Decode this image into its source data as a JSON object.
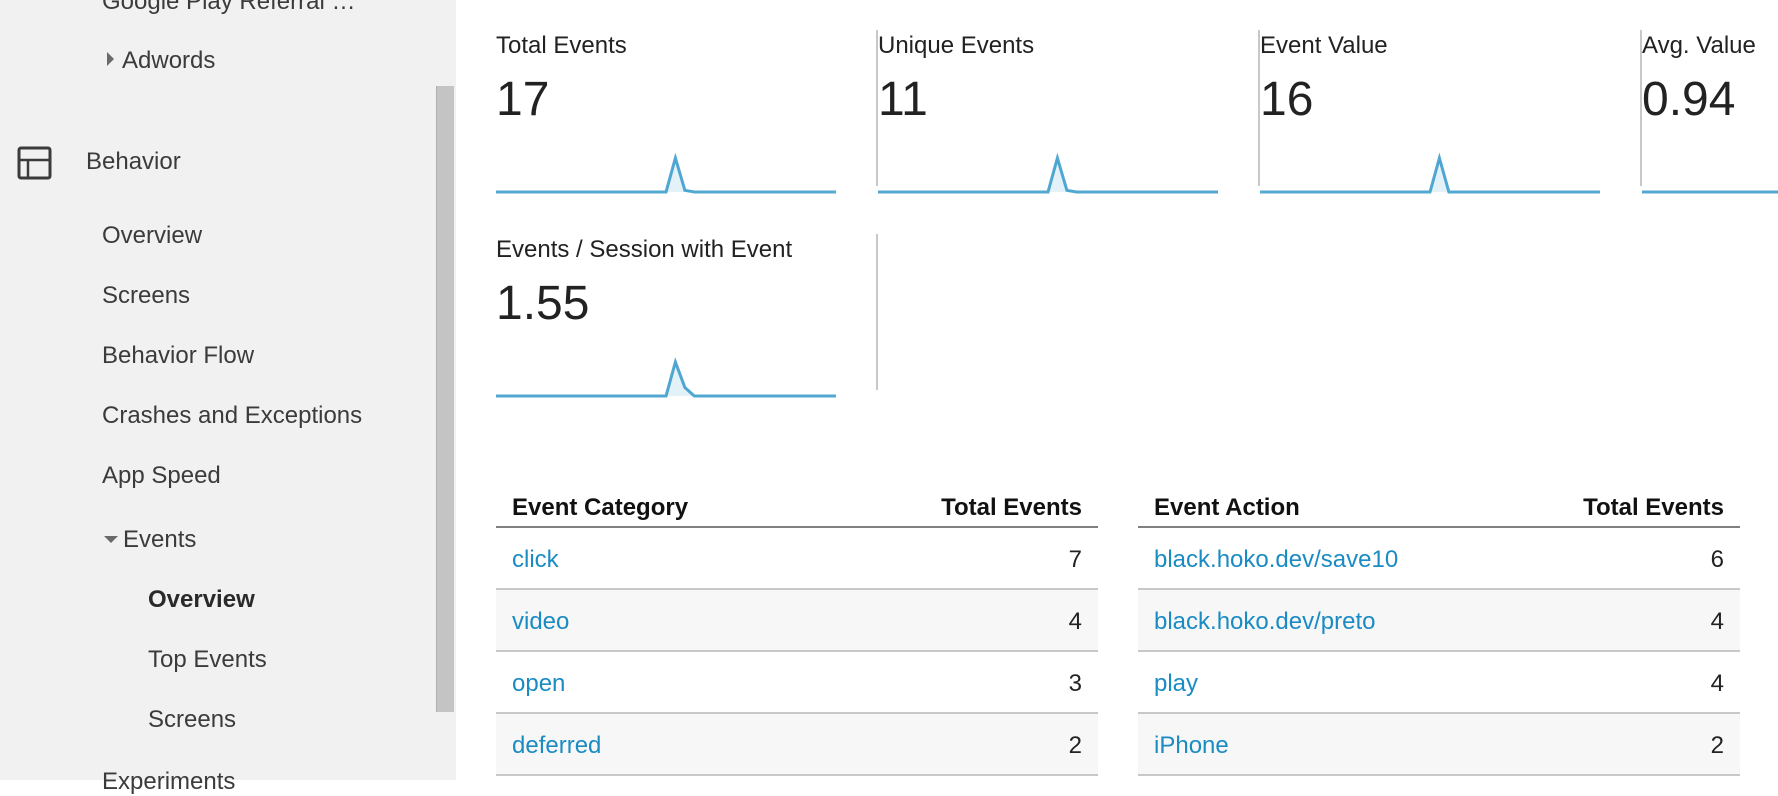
{
  "sidebar": {
    "items": [
      {
        "label": "Google Play Referral …",
        "name": "sidebar-item-google-play-referral"
      },
      {
        "label": "Adwords",
        "name": "sidebar-item-adwords"
      },
      {
        "label": "Behavior",
        "name": "sidebar-item-behavior"
      },
      {
        "label": "Overview",
        "name": "sidebar-item-behavior-overview"
      },
      {
        "label": "Screens",
        "name": "sidebar-item-screens"
      },
      {
        "label": "Behavior Flow",
        "name": "sidebar-item-behavior-flow"
      },
      {
        "label": "Crashes and Exceptions",
        "name": "sidebar-item-crashes-and-exceptions"
      },
      {
        "label": "App Speed",
        "name": "sidebar-item-app-speed"
      },
      {
        "label": "Events",
        "name": "sidebar-item-events"
      },
      {
        "label": "Overview",
        "name": "sidebar-item-events-overview"
      },
      {
        "label": "Top Events",
        "name": "sidebar-item-top-events"
      },
      {
        "label": "Screens",
        "name": "sidebar-item-events-screens"
      },
      {
        "label": "Experiments",
        "name": "sidebar-item-experiments"
      }
    ]
  },
  "kpis": [
    {
      "label": "Total Events",
      "value": "17",
      "spark": [
        0,
        0,
        0,
        0,
        0,
        0,
        0,
        0,
        0,
        0,
        0,
        0,
        0,
        0,
        0,
        0,
        0,
        0,
        0,
        1,
        0.05,
        0,
        0,
        0,
        0,
        0,
        0,
        0,
        0,
        0,
        0,
        0,
        0,
        0,
        0,
        0,
        0
      ]
    },
    {
      "label": "Unique Events",
      "value": "11",
      "spark": [
        0,
        0,
        0,
        0,
        0,
        0,
        0,
        0,
        0,
        0,
        0,
        0,
        0,
        0,
        0,
        0,
        0,
        0,
        0,
        1,
        0.05,
        0,
        0,
        0,
        0,
        0,
        0,
        0,
        0,
        0,
        0,
        0,
        0,
        0,
        0,
        0,
        0
      ]
    },
    {
      "label": "Event Value",
      "value": "16",
      "spark": [
        0,
        0,
        0,
        0,
        0,
        0,
        0,
        0,
        0,
        0,
        0,
        0,
        0,
        0,
        0,
        0,
        0,
        0,
        0,
        1,
        0,
        0,
        0,
        0,
        0,
        0,
        0,
        0,
        0,
        0,
        0,
        0,
        0,
        0,
        0,
        0,
        0
      ]
    },
    {
      "label": "Avg. Value",
      "value": "0.94",
      "spark": [
        0,
        0,
        0,
        0,
        0,
        0,
        0,
        0,
        0,
        0,
        0,
        0,
        0,
        0,
        0,
        0,
        0,
        0,
        0,
        0,
        0,
        0,
        0,
        0,
        0,
        0,
        0,
        0,
        0,
        0,
        0,
        0,
        0,
        0,
        0,
        0,
        0
      ]
    },
    {
      "label": "Events / Session with Event",
      "value": "1.55",
      "spark": [
        0,
        0,
        0,
        0,
        0,
        0,
        0,
        0,
        0,
        0,
        0,
        0,
        0,
        0,
        0,
        0,
        0,
        0,
        0,
        1,
        0.25,
        0,
        0,
        0,
        0,
        0,
        0,
        0,
        0,
        0,
        0,
        0,
        0,
        0,
        0,
        0,
        0
      ]
    }
  ],
  "tables": [
    {
      "header": {
        "dimension": "Event Category",
        "metric": "Total Events"
      },
      "rows": [
        {
          "name": "click",
          "value": "7"
        },
        {
          "name": "video",
          "value": "4"
        },
        {
          "name": "open",
          "value": "3"
        },
        {
          "name": "deferred",
          "value": "2"
        }
      ]
    },
    {
      "header": {
        "dimension": "Event Action",
        "metric": "Total Events"
      },
      "rows": [
        {
          "name": "black.hoko.dev/save10",
          "value": "6"
        },
        {
          "name": "black.hoko.dev/preto",
          "value": "4"
        },
        {
          "name": "play",
          "value": "4"
        },
        {
          "name": "iPhone",
          "value": "2"
        }
      ]
    }
  ],
  "colors": {
    "accent": "#1a8bc3",
    "spark_line": "#1a8bc3",
    "spark_fill": "#e3f1f9",
    "sidebar_bg": "#f1f1f1"
  }
}
